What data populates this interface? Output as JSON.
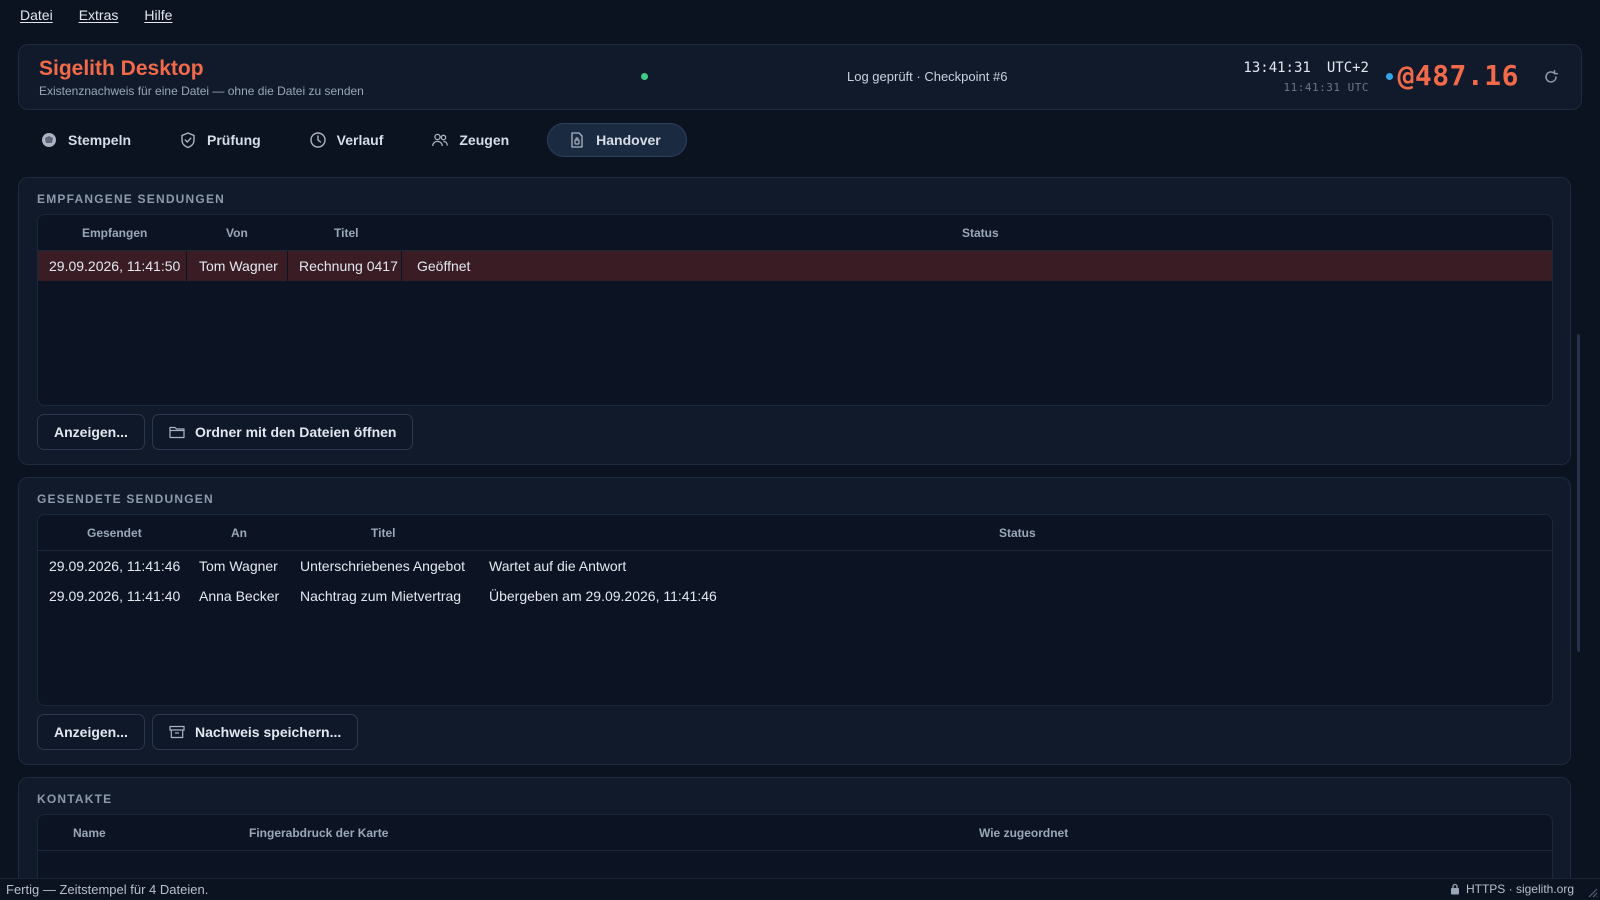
{
  "menu": [
    "Datei",
    "Extras",
    "Hilfe"
  ],
  "header": {
    "title": "Sigelith Desktop",
    "subtitle": "Existenznachweis für eine Datei — ohne die Datei zu senden",
    "log_status": "Log geprüft · Checkpoint #6",
    "time_local": "13:41:31",
    "timezone": "UTC+2",
    "time_utc": "11:41:31 UTC",
    "counter": "@487.16"
  },
  "tabs": [
    {
      "label": "Stempeln",
      "icon": "stamp-icon"
    },
    {
      "label": "Prüfung",
      "icon": "shield-icon"
    },
    {
      "label": "Verlauf",
      "icon": "clock-icon"
    },
    {
      "label": "Zeugen",
      "icon": "users-icon"
    },
    {
      "label": "Handover",
      "icon": "document-icon",
      "active": true
    }
  ],
  "received": {
    "title": "EMPFANGENE SENDUNGEN",
    "columns": [
      "Empfangen",
      "Von",
      "Titel",
      "Status"
    ],
    "rows": [
      {
        "date": "29.09.2026, 11:41:50",
        "from": "Tom Wagner",
        "title": "Rechnung 0417",
        "status": "Geöffnet"
      }
    ],
    "btn_view": "Anzeigen...",
    "btn_folder": "Ordner mit den Dateien öffnen"
  },
  "sent": {
    "title": "GESENDETE SENDUNGEN",
    "columns": [
      "Gesendet",
      "An",
      "Titel",
      "Status"
    ],
    "rows": [
      {
        "date": "29.09.2026, 11:41:46",
        "to": "Tom Wagner",
        "title": "Unterschriebenes Angebot",
        "status": "Wartet auf die Antwort"
      },
      {
        "date": "29.09.2026, 11:41:40",
        "to": "Anna Becker",
        "title": "Nachtrag zum Mietvertrag",
        "status": "Übergeben am 29.09.2026, 11:41:46"
      }
    ],
    "btn_view": "Anzeigen...",
    "btn_save": "Nachweis speichern..."
  },
  "contacts": {
    "title": "KONTAKTE",
    "columns": [
      "Name",
      "Fingerabdruck der Karte",
      "Wie zugeordnet"
    ]
  },
  "statusbar": {
    "message": "Fertig — Zeitstempel für 4 Dateien.",
    "connection": "HTTPS · sigelith.org"
  },
  "colors": {
    "accent": "#f26a4a",
    "online": "#3ccf86",
    "info": "#38a4e8",
    "selected_row": "#3a1d24"
  }
}
